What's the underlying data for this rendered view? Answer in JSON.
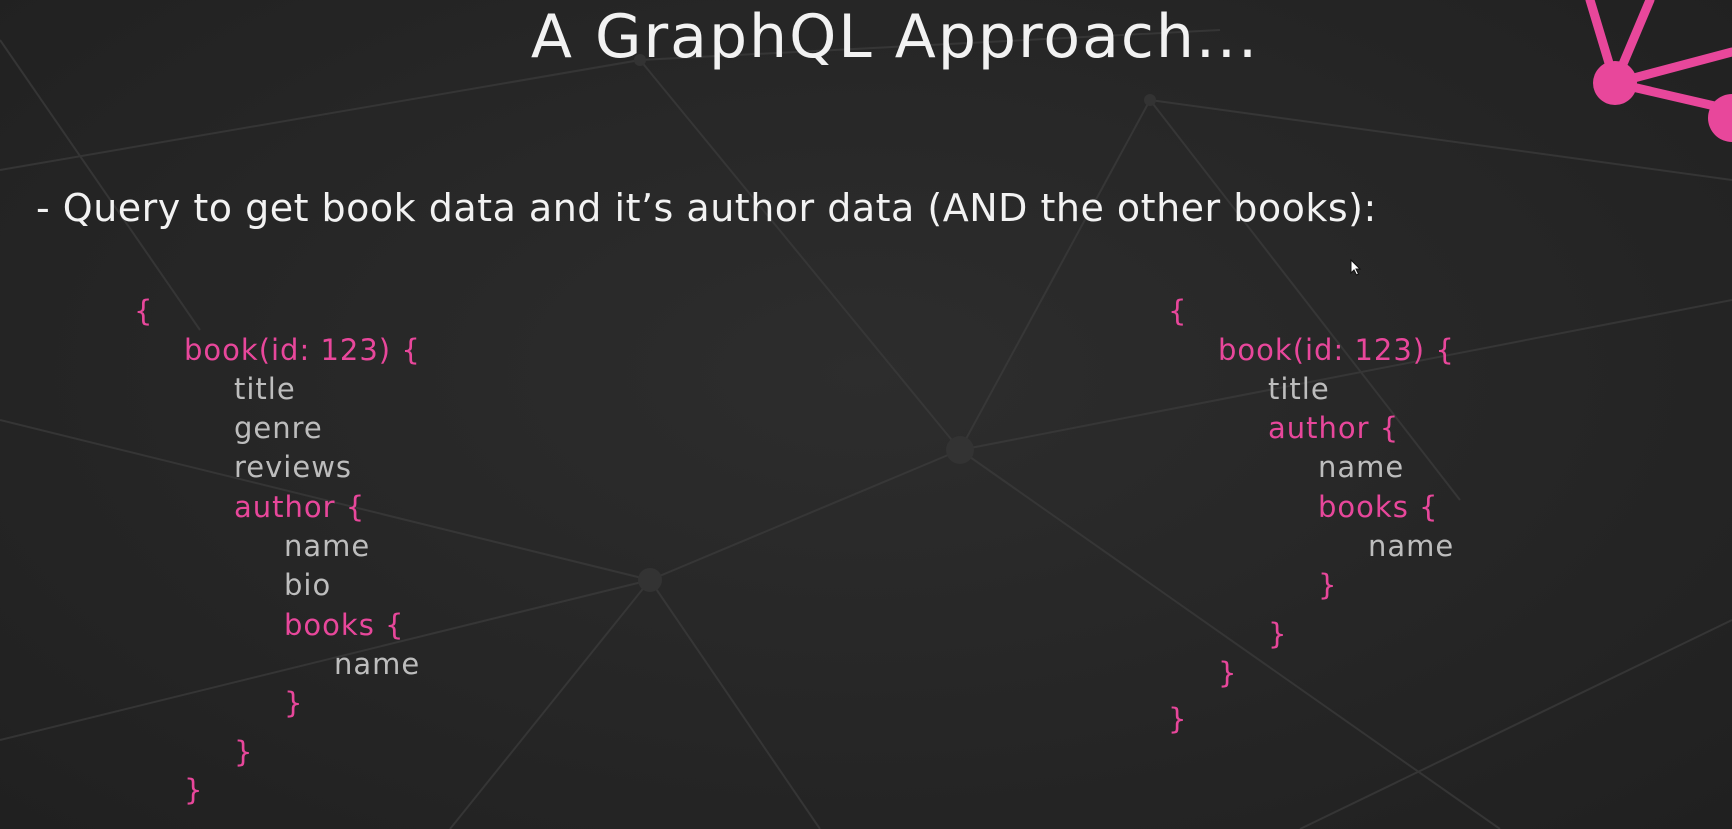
{
  "slide": {
    "title": "A GraphQL Approach...",
    "bullet": "- Query to get book data and it’s author data (AND the other books):"
  },
  "colors": {
    "background": "#262626",
    "accent_pink": "#e8479b",
    "field_gray": "#bdbdbd",
    "text_white": "#f2f2f2"
  },
  "query_left": {
    "lines": [
      {
        "text": "{",
        "kind": "kw"
      },
      {
        "text": "book(id: 123) {",
        "kind": "kw"
      },
      {
        "text": "title",
        "kind": "field"
      },
      {
        "text": "genre",
        "kind": "field"
      },
      {
        "text": "reviews",
        "kind": "field"
      },
      {
        "text": "author {",
        "kind": "kw"
      },
      {
        "text": "name",
        "kind": "field"
      },
      {
        "text": "bio",
        "kind": "field"
      },
      {
        "text": "books {",
        "kind": "kw"
      },
      {
        "text": "name",
        "kind": "field"
      },
      {
        "text": "}",
        "kind": "kw"
      },
      {
        "text": "}",
        "kind": "kw"
      },
      {
        "text": "}",
        "kind": "kw"
      }
    ]
  },
  "query_right": {
    "lines": [
      {
        "text": "{",
        "kind": "kw"
      },
      {
        "text": "book(id: 123) {",
        "kind": "kw"
      },
      {
        "text": "title",
        "kind": "field"
      },
      {
        "text": "author {",
        "kind": "kw"
      },
      {
        "text": "name",
        "kind": "field"
      },
      {
        "text": "books {",
        "kind": "kw"
      },
      {
        "text": "name",
        "kind": "field"
      },
      {
        "text": "}",
        "kind": "kw"
      },
      {
        "text": "}",
        "kind": "kw"
      },
      {
        "text": "}",
        "kind": "kw"
      },
      {
        "text": "}",
        "kind": "kw"
      }
    ]
  }
}
